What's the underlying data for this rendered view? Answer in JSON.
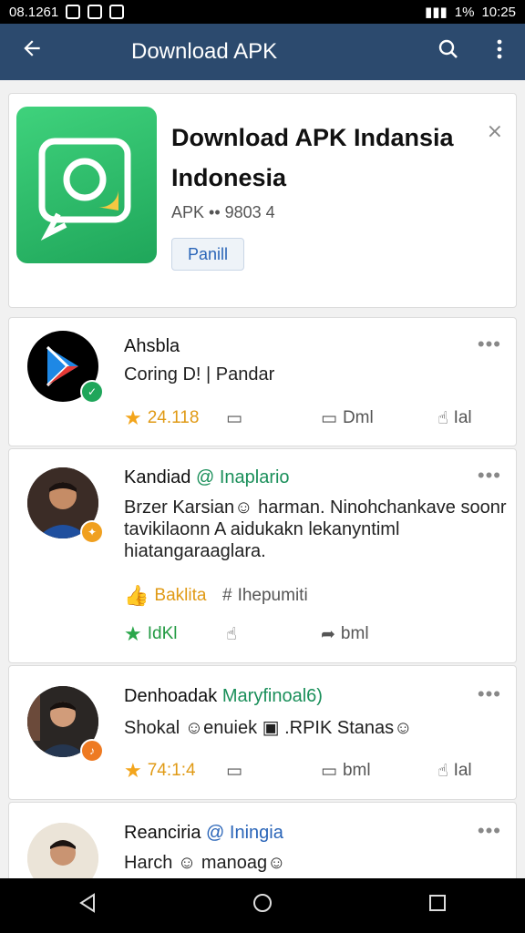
{
  "status_bar": {
    "left_text": "08.1261",
    "right_text": "10:25",
    "battery": "1%"
  },
  "app_bar": {
    "title": "Download APK",
    "back_icon": "arrow-left-icon",
    "search_icon": "search-icon",
    "menu_icon": "more-vert-icon"
  },
  "app_card": {
    "title_line1": "Download APK Indansia",
    "title_line2": "Indonesia",
    "meta": "APK •• 9803 4",
    "pill": "Panill",
    "close": "⨯"
  },
  "posts": [
    {
      "name": "Ahsbla",
      "handle": "",
      "body": "Coring D! | Pandar",
      "stat1": "24.118",
      "stat2": "Dml",
      "stat3": "Ial"
    },
    {
      "name": "Kandiad",
      "handle": "@ Inaplario",
      "body": "Brzer Karsian☺ harman. Ninohchankave soonr tavikilaonn A aidukakn lekanyntiml hiatangaraaglara.",
      "stat_orange": "Baklita",
      "stat_extra": "Ihepumiti",
      "stat1": "IdKl",
      "stat3": "bml"
    },
    {
      "name": "Denhoadak",
      "handle": "Maryfinoal6)",
      "body": "Shokal ☺enuiek ▣ .RPIK Stanas☺",
      "stat1": "74:1:4",
      "stat2": "bml",
      "stat3": "Ial"
    },
    {
      "name": "Reanciria",
      "handle": "@ Iningia",
      "body": "Harch ☺ manoag☺"
    }
  ],
  "colors": {
    "app_bar": "#2c4a6e",
    "accent_green": "#1fa65a",
    "star": "#f3a51c"
  }
}
